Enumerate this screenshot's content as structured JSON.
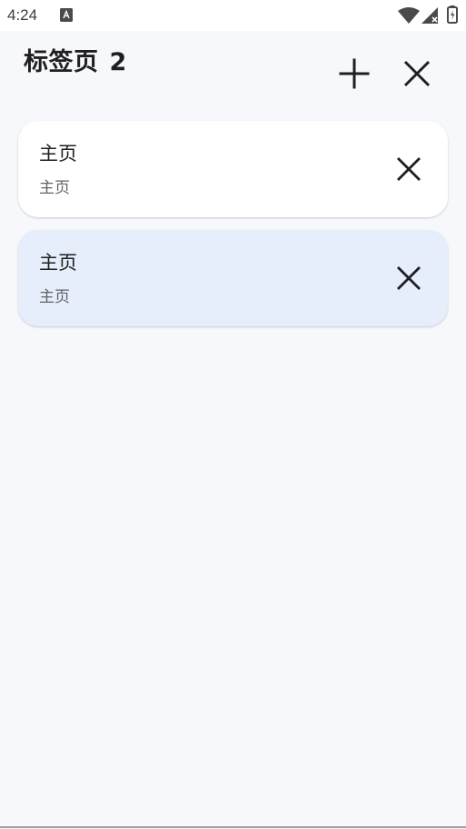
{
  "status_bar": {
    "time": "4:24",
    "icons": [
      "notification-a-icon",
      "wifi-icon",
      "signal-icon",
      "battery-icon"
    ]
  },
  "header": {
    "title": "标签页",
    "count": "2",
    "add_icon": "plus-icon",
    "close_all_icon": "close-icon"
  },
  "tabs": [
    {
      "title": "主页",
      "subtitle": "主页",
      "active": false
    },
    {
      "title": "主页",
      "subtitle": "主页",
      "active": true
    }
  ],
  "colors": {
    "background": "#f7f8fb",
    "card": "#ffffff",
    "active_card": "#e6edfb",
    "text": "#1f1f1f",
    "secondary_text": "#5f6368"
  }
}
